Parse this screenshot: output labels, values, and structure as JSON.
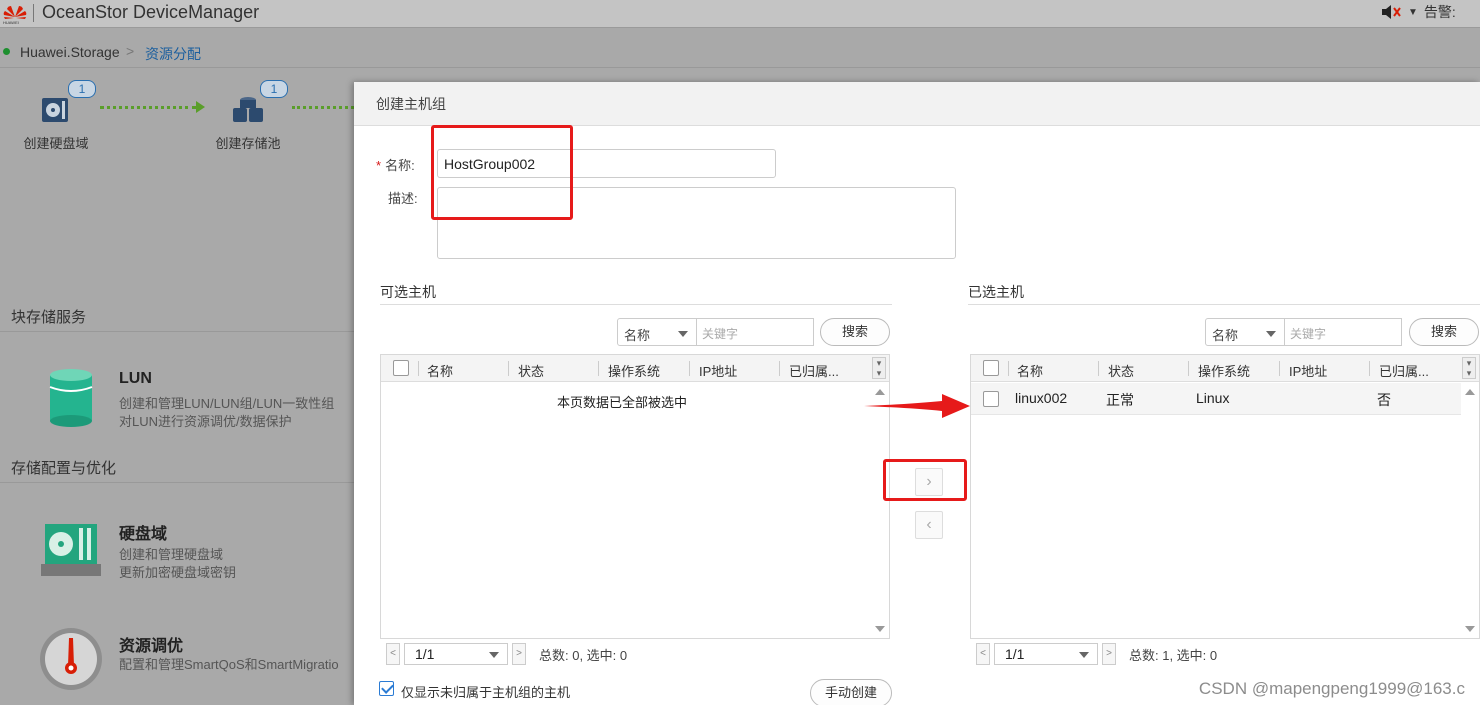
{
  "app": {
    "title": "OceanStor DeviceManager",
    "alarm_label": "告警:",
    "brand_color": "#d81e06"
  },
  "breadcrumb": {
    "home": "Huawei.Storage",
    "separator": ">",
    "current": "资源分配"
  },
  "workflow": [
    {
      "label": "创建硬盘域",
      "badge": "1",
      "icon": "disk-domain-icon"
    },
    {
      "label": "创建存储池",
      "badge": "1",
      "icon": "storage-pool-icon"
    }
  ],
  "sections": {
    "block_service": "块存储服务",
    "storage_config": "存储配置与优化"
  },
  "services": [
    {
      "name": "LUN",
      "desc": [
        "创建和管理LUN/LUN组/LUN一致性组",
        "对LUN进行资源调优/数据保护"
      ],
      "icon": "lun-icon"
    },
    {
      "name": "硬盘域",
      "desc": [
        "创建和管理硬盘域",
        "更新加密硬盘域密钥"
      ],
      "icon": "disk-domain-icon"
    },
    {
      "name": "资源调优",
      "desc": [
        "配置和管理SmartQoS和SmartMigratio"
      ],
      "icon": "gauge-icon"
    }
  ],
  "dialog": {
    "title": "创建主机组",
    "name_label": "名称:",
    "name_value": "HostGroup002",
    "desc_label": "描述:",
    "desc_value": "",
    "available": {
      "title": "可选主机",
      "filter_field": "名称",
      "keyword_placeholder": "关键字",
      "search_label": "搜索",
      "columns": [
        "名称",
        "状态",
        "操作系统",
        "IP地址",
        "已归属..."
      ],
      "empty_message": "本页数据已全部被选中",
      "page": "1/1",
      "total": "总数: 0, 选中: 0"
    },
    "selected": {
      "title": "已选主机",
      "filter_field": "名称",
      "keyword_placeholder": "关键字",
      "search_label": "搜索",
      "columns": [
        "名称",
        "状态",
        "操作系统",
        "IP地址",
        "已归属..."
      ],
      "rows": [
        {
          "name": "linux002",
          "status": "正常",
          "os": "Linux",
          "ip": "",
          "belongs": "否"
        }
      ],
      "page": "1/1",
      "total": "总数: 1, 选中: 0"
    },
    "move_right": "›",
    "move_left": "‹",
    "filter_option": {
      "label": "仅显示未归属于主机组的主机",
      "checked": true
    },
    "manual_create": "手动创建"
  },
  "annotation_color": "#e61a1a",
  "watermark": "CSDN @mapengpeng1999@163.c"
}
